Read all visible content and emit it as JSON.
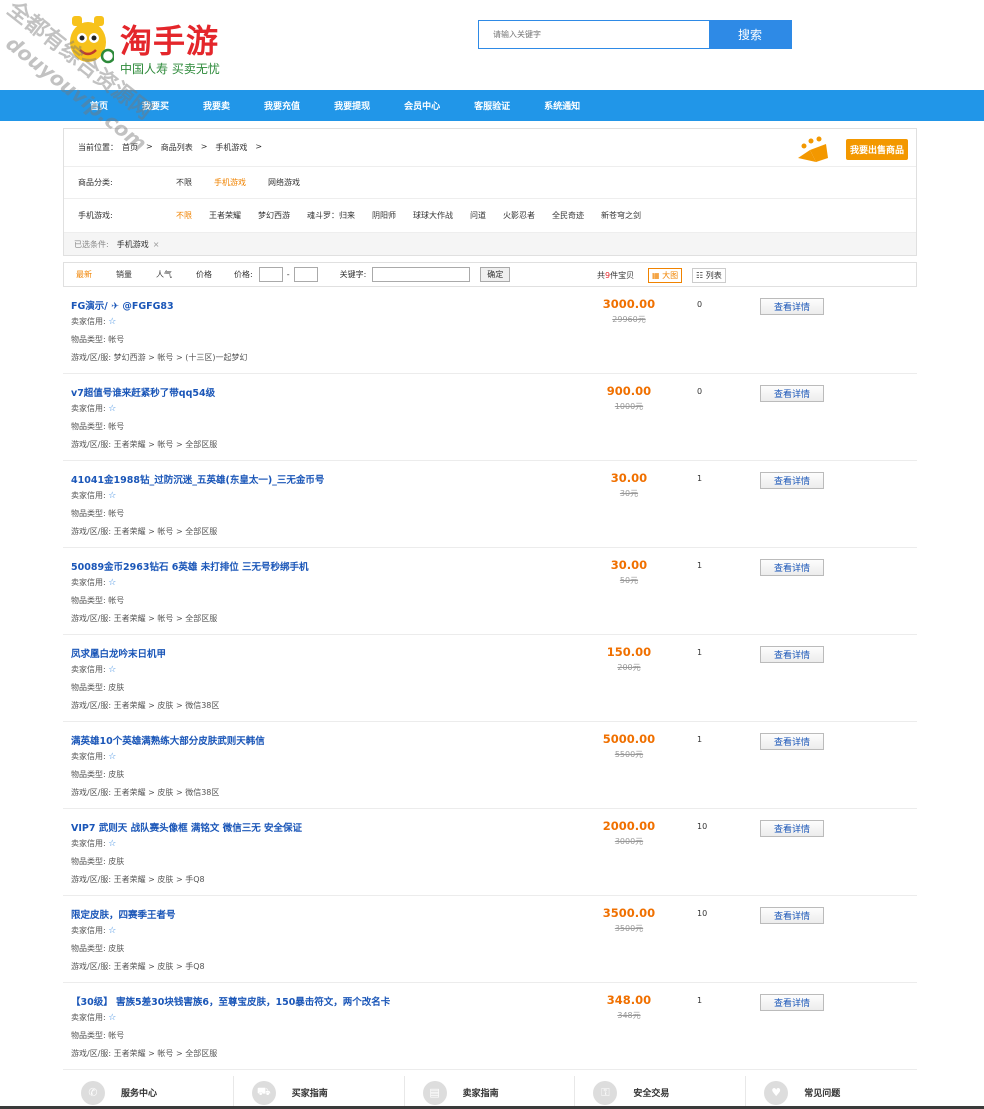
{
  "logo": {
    "title": "淘手游",
    "slogan": "中国人寿 买卖无忧"
  },
  "watermark": {
    "line1": "全都有综合资源网",
    "line2": "douyouvip.com"
  },
  "search": {
    "placeholder": "请输入关键字",
    "button": "搜索"
  },
  "nav": [
    "首页",
    "我要买",
    "我要卖",
    "我要充值",
    "我要提现",
    "会员中心",
    "客服验证",
    "系统通知"
  ],
  "breadcrumb": {
    "label": "当前位置：",
    "items": [
      "首页",
      ">",
      "商品列表",
      ">",
      "手机游戏",
      ">"
    ]
  },
  "sell_button": "我要出售商品",
  "category": {
    "label": "商品分类:",
    "items": [
      "不限",
      "手机游戏",
      "网络游戏"
    ],
    "active_index": 1
  },
  "games": {
    "label": "手机游戏:",
    "items": [
      "不限",
      "王者荣耀",
      "梦幻西游",
      "魂斗罗：归来",
      "阴阳师",
      "球球大作战",
      "问道",
      "火影忍者",
      "全民奇迹",
      "新苍穹之剑"
    ],
    "active_index": 0
  },
  "selected": {
    "label": "已选条件:",
    "tag": "手机游戏",
    "remove": "×"
  },
  "sort": {
    "items": [
      "最新",
      "销量",
      "人气",
      "价格"
    ],
    "price_label": "价格:",
    "dash": "-",
    "keyword_label": "关键字:",
    "confirm": "确定",
    "total_prefix": "共",
    "total_count": "9",
    "total_suffix": "件宝贝",
    "view_big": "大图",
    "view_list": "列表"
  },
  "labels": {
    "seller_credit": "卖家信用:",
    "item_type": "物品类型:",
    "game_server": "游戏/区/服:",
    "detail": "查看详情",
    "yuan": "元"
  },
  "items": [
    {
      "title": "FG演示/ ✈ @FGFG83",
      "type": "帐号",
      "path": "梦幻西游 > 帐号 > (十三区)一起梦幻",
      "price": "3000.00",
      "old_price": "29960元",
      "qty": "0"
    },
    {
      "title": "v7超值号谁来赶紧秒了带qq54级",
      "type": "帐号",
      "path": "王者荣耀 > 帐号 > 全部区服",
      "price": "900.00",
      "old_price": "1000元",
      "qty": "0"
    },
    {
      "title": "41041金1988钻_过防沉迷_五英雄(东皇太一)_三无金币号",
      "type": "帐号",
      "path": "王者荣耀 > 帐号 > 全部区服",
      "price": "30.00",
      "old_price": "30元",
      "qty": "1"
    },
    {
      "title": "50089金币2963钻石 6英雄 未打排位 三无号秒绑手机",
      "type": "帐号",
      "path": "王者荣耀 > 帐号 > 全部区服",
      "price": "30.00",
      "old_price": "50元",
      "qty": "1"
    },
    {
      "title": "凤求凰白龙吟末日机甲",
      "type": "皮肤",
      "path": "王者荣耀 > 皮肤 > 微信38区",
      "price": "150.00",
      "old_price": "200元",
      "qty": "1"
    },
    {
      "title": "满英雄10个英雄满熟练大部分皮肤武则天韩信",
      "type": "皮肤",
      "path": "王者荣耀 > 皮肤 > 微信38区",
      "price": "5000.00",
      "old_price": "5500元",
      "qty": "1"
    },
    {
      "title": "VIP7 武则天 战队赛头像框 满铭文 微信三无 安全保证",
      "type": "皮肤",
      "path": "王者荣耀 > 皮肤 > 手Q8",
      "price": "2000.00",
      "old_price": "3000元",
      "qty": "10"
    },
    {
      "title": "限定皮肤，四赛季王者号",
      "type": "皮肤",
      "path": "王者荣耀 > 皮肤 > 手Q8",
      "price": "3500.00",
      "old_price": "3500元",
      "qty": "10"
    },
    {
      "title": "【30级】 害族5差30块钱害族6，至尊宝皮肤，150暴击符文，两个改名卡",
      "type": "帐号",
      "path": "王者荣耀 > 帐号 > 全部区服",
      "price": "348.00",
      "old_price": "348元",
      "qty": "1"
    }
  ],
  "footer": [
    {
      "label": "服务中心",
      "icon": "service-icon"
    },
    {
      "label": "买家指南",
      "icon": "buyer-icon"
    },
    {
      "label": "卖家指南",
      "icon": "seller-icon"
    },
    {
      "label": "安全交易",
      "icon": "security-icon"
    },
    {
      "label": "常见问题",
      "icon": "faq-icon"
    }
  ],
  "colors": {
    "nav_bg": "#2196e8",
    "accent_orange": "#f08300",
    "link_blue": "#1a56b8",
    "logo_red": "#e4262b",
    "logo_green": "#2d8a3a"
  }
}
